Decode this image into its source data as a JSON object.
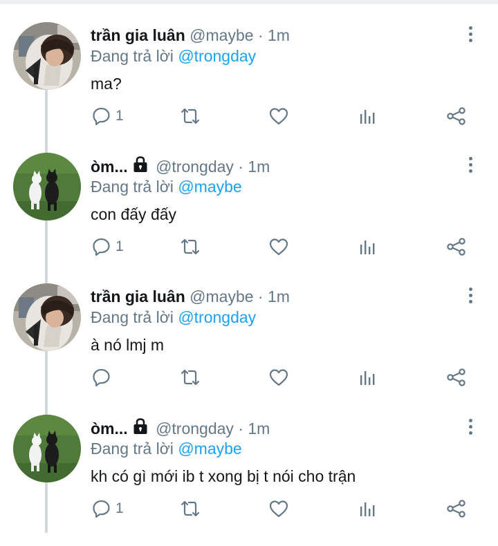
{
  "tweets": [
    {
      "name": "trần gia luân",
      "locked": false,
      "handle": "@maybe",
      "dot": "·",
      "time": "1m",
      "reply_prefix": "Đang trả lời",
      "reply_to": "@trongday",
      "text": "ma?",
      "reply_count": "1",
      "avatar": "person-photo"
    },
    {
      "name": "òm...",
      "locked": true,
      "handle": "@trongday",
      "dot": "·",
      "time": "1m",
      "reply_prefix": "Đang trả lời",
      "reply_to": "@maybe",
      "text": "con đấy đấy",
      "reply_count": "1",
      "avatar": "cats-photo"
    },
    {
      "name": "trần gia luân",
      "locked": false,
      "handle": "@maybe",
      "dot": "·",
      "time": "1m",
      "reply_prefix": "Đang trả lời",
      "reply_to": "@trongday",
      "text": "à nó lmj m",
      "reply_count": "",
      "avatar": "person-photo"
    },
    {
      "name": "òm...",
      "locked": true,
      "handle": "@trongday",
      "dot": "·",
      "time": "1m",
      "reply_prefix": "Đang trả lời",
      "reply_to": "@maybe",
      "text": "kh có gì mới ib t xong bị t nói cho trận",
      "reply_count": "1",
      "avatar": "cats-photo"
    }
  ],
  "icons": {
    "reply": "reply-icon",
    "retweet": "retweet-icon",
    "like": "heart-icon",
    "analytics": "analytics-icon",
    "share": "share-icon",
    "more": "more-vertical-icon",
    "lock": "lock-icon"
  },
  "colors": {
    "text": "#14171a",
    "secondary": "#657786",
    "mention": "#1da1f2",
    "thread_line": "#d3d8dc"
  }
}
